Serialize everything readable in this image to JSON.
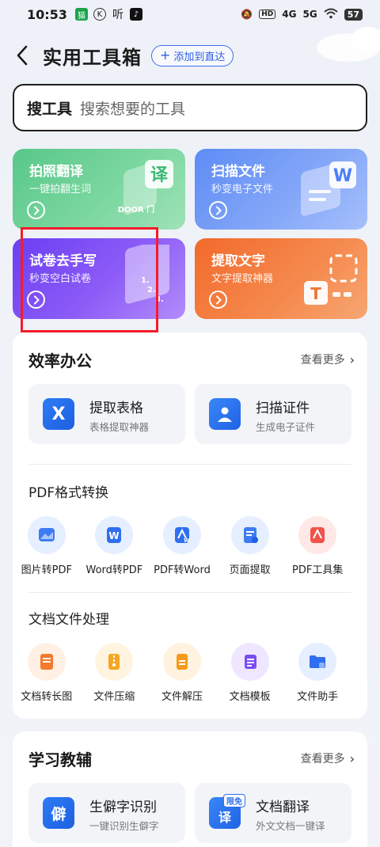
{
  "status_bar": {
    "time": "10:53",
    "network_1": "4G",
    "network_2": "5G",
    "battery": "57"
  },
  "header": {
    "title": "实用工具箱",
    "add_label": "添加到直达"
  },
  "search": {
    "label": "搜工具",
    "placeholder": "搜索想要的工具"
  },
  "feature_cards": [
    {
      "title": "拍照翻译",
      "subtitle": "一键拍翻生词",
      "art_text_1": "译",
      "art_text_2": "DOOR 门"
    },
    {
      "title": "扫描文件",
      "subtitle": "秒变电子文件",
      "art_text_1": "W"
    },
    {
      "title": "试卷去手写",
      "subtitle": "秒变空白试卷",
      "art_text_1": "1.",
      "art_text_2": "2.",
      "art_text_3": "3."
    },
    {
      "title": "提取文字",
      "subtitle": "文字提取神器",
      "art_text_1": "T"
    }
  ],
  "office": {
    "title": "效率办公",
    "more": "查看更多",
    "tools": [
      {
        "title": "提取表格",
        "subtitle": "表格提取神器",
        "icon_glyph": "X"
      },
      {
        "title": "扫描证件",
        "subtitle": "生成电子证件"
      }
    ]
  },
  "pdf": {
    "title": "PDF格式转换",
    "items": [
      {
        "label": "图片转PDF"
      },
      {
        "label": "Word转PDF",
        "glyph": "W"
      },
      {
        "label": "PDF转Word",
        "glyph": "W"
      },
      {
        "label": "页面提取"
      },
      {
        "label": "PDF工具集"
      }
    ]
  },
  "doc": {
    "title": "文档文件处理",
    "items": [
      {
        "label": "文档转长图"
      },
      {
        "label": "文件压缩"
      },
      {
        "label": "文件解压"
      },
      {
        "label": "文档模板"
      },
      {
        "label": "文件助手"
      }
    ]
  },
  "study": {
    "title": "学习教辅",
    "more": "查看更多",
    "tools": [
      {
        "title": "生僻字识别",
        "subtitle": "一键识别生僻字",
        "icon_glyph": "僻"
      },
      {
        "title": "文档翻译",
        "subtitle": "外文文档一键译",
        "badge": "限免",
        "icon_glyph": "译"
      }
    ]
  },
  "colors": {
    "accent": "#3b6ef0",
    "highlight": "#f21d2a"
  }
}
